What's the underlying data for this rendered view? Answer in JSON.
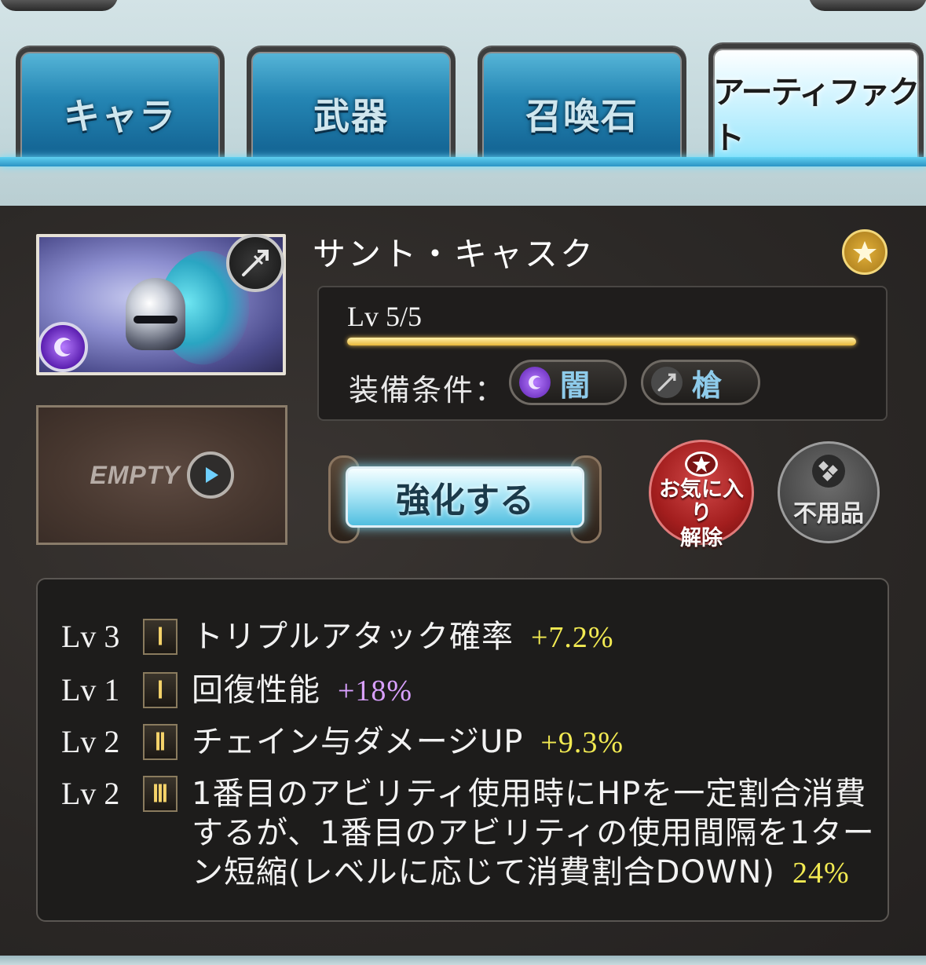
{
  "tabs": [
    {
      "label": "キャラ",
      "active": false
    },
    {
      "label": "武器",
      "active": false
    },
    {
      "label": "召喚石",
      "active": false
    },
    {
      "label": "アーティファクト",
      "active": true
    }
  ],
  "item": {
    "name": "サント・キャスク",
    "level": "Lv 5/5",
    "level_progress": 1.0,
    "equip_label": "装備条件：",
    "conditions": [
      {
        "label": "闇",
        "icon": "dark-element-icon"
      },
      {
        "label": "槍",
        "icon": "spear-icon"
      }
    ],
    "empty_label": "EMPTY",
    "favorite": true
  },
  "actions": {
    "enhance": "強化する",
    "unfavorite_line1": "お気に入り",
    "unfavorite_line2": "解除",
    "unneeded": "不用品"
  },
  "skills": [
    {
      "lv": "Lv 3",
      "tier": "I",
      "text": "トリプルアタック確率",
      "value": "+7.2%",
      "color": "#f2ea52"
    },
    {
      "lv": "Lv 1",
      "tier": "I",
      "text": "回復性能",
      "value": "+18%",
      "color": "#d9a0ff"
    },
    {
      "lv": "Lv 2",
      "tier": "II",
      "text": "チェイン与ダメージUP",
      "value": "+9.3%",
      "color": "#f2ea52"
    },
    {
      "lv": "Lv 2",
      "tier": "III",
      "line1": "1番目のアビリティ使用時にHPを一定割合消費",
      "line2": "するが、1番目のアビリティの使用間隔を1ター",
      "line3": "ン短縮(レベルに応じて消費割合DOWN)",
      "value": "24%",
      "color": "#f2ea52"
    }
  ]
}
